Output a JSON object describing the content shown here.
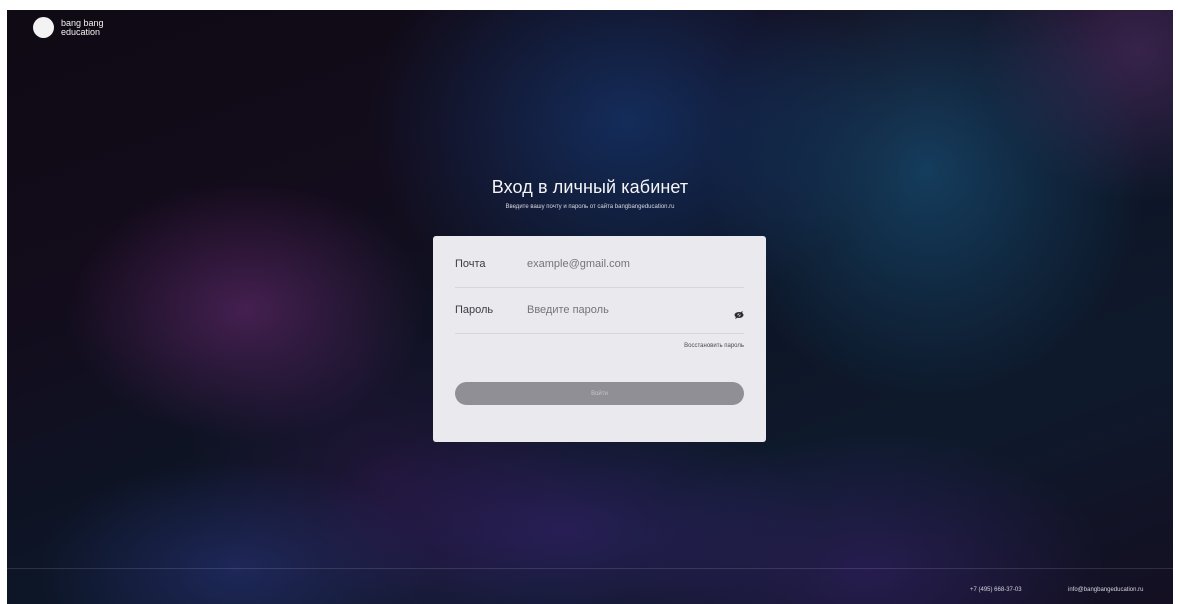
{
  "logo": {
    "line1": "bang bang",
    "line2": "education"
  },
  "login": {
    "title": "Вход в личный кабинет",
    "subtitle": "Введите вашу почту и пароль от сайта bangbangeducation.ru",
    "email_label": "Почта",
    "email_placeholder": "example@gmail.com",
    "password_label": "Пароль",
    "password_placeholder": "Введите пароль",
    "password_toggle_icon": "eye-icon",
    "restore_label": "Восстановить пароль",
    "submit_label": "Войти"
  },
  "footer": {
    "phone": "+7 (495) 668-37-03",
    "email": "info@bangbangeducation.ru"
  },
  "colors": {
    "card_bg": "#eaeaee",
    "button_disabled": "#8f8f95",
    "background_dark": "#0f0a14"
  }
}
